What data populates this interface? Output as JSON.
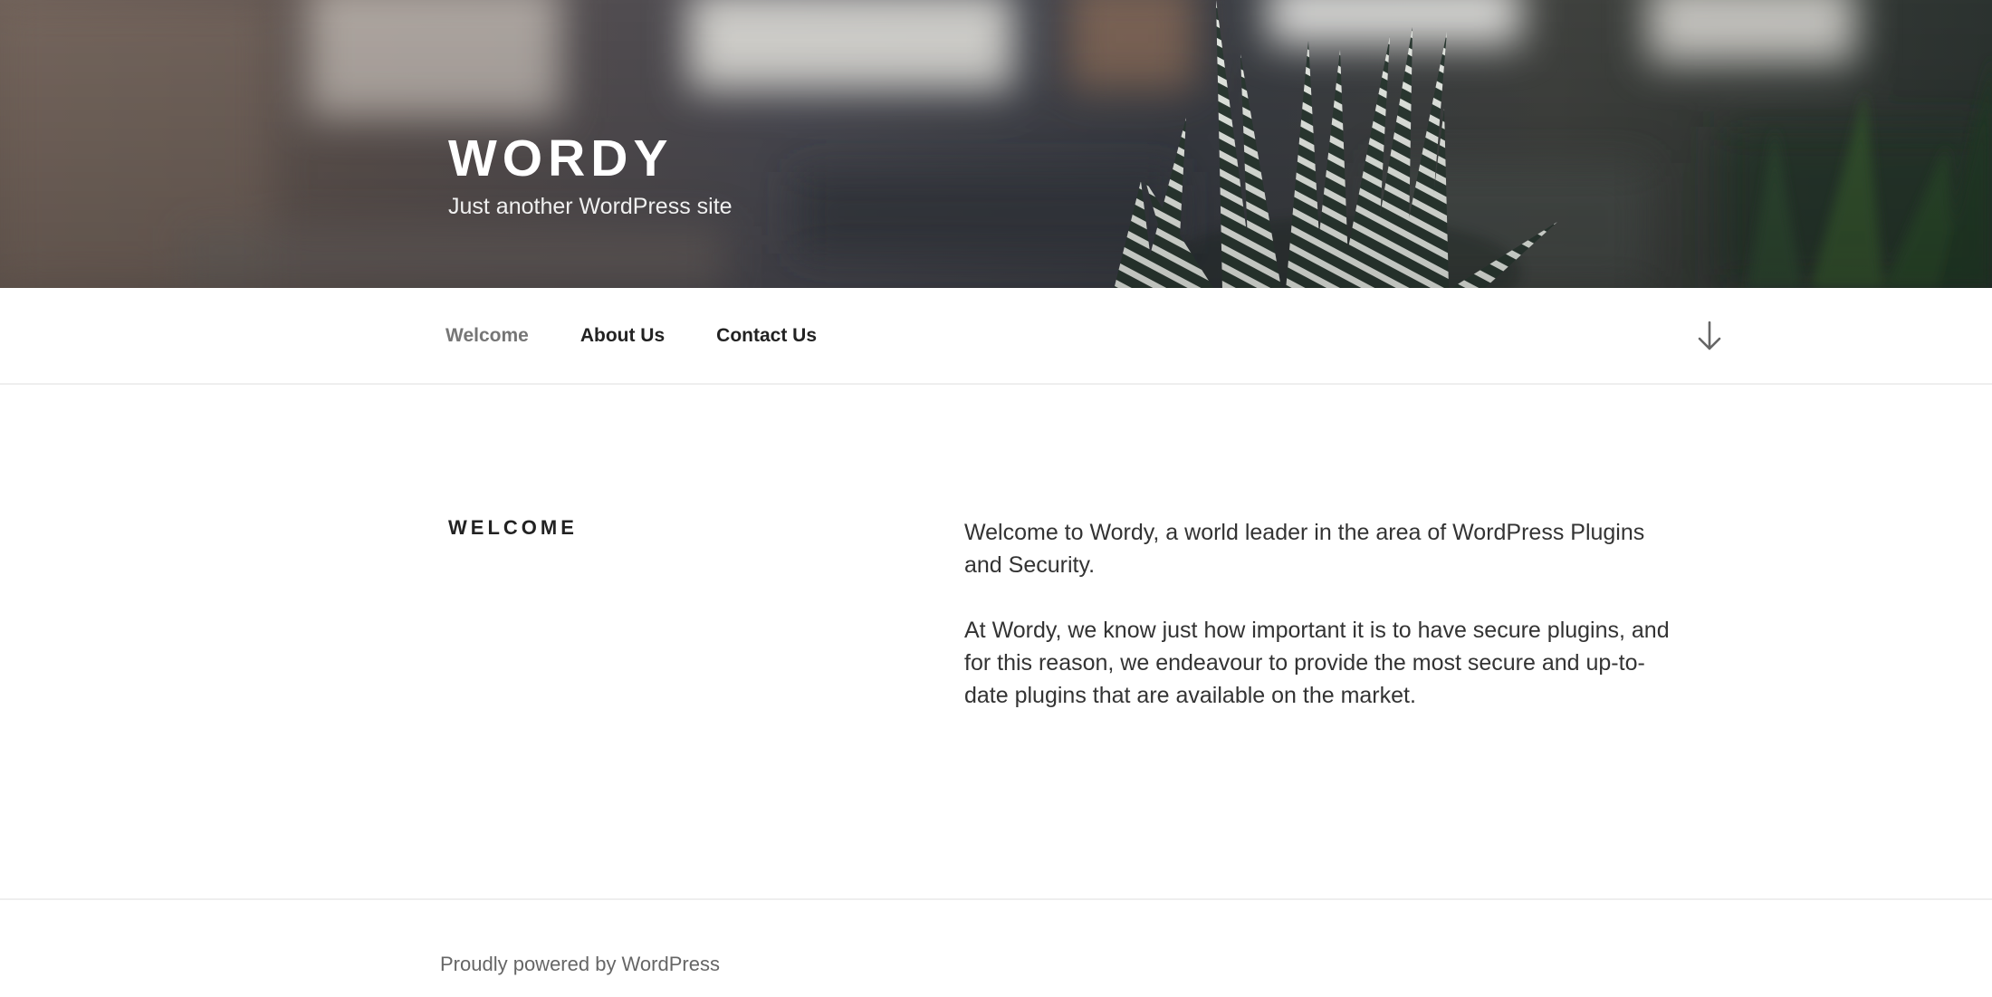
{
  "header": {
    "site_title": "WORDY",
    "site_description": "Just another WordPress site"
  },
  "nav": {
    "items": [
      {
        "label": "Welcome",
        "current": true
      },
      {
        "label": "About Us",
        "current": false
      },
      {
        "label": "Contact Us",
        "current": false
      }
    ],
    "scroll_icon": "arrow-down-icon"
  },
  "main": {
    "entry_title": "WELCOME",
    "paragraphs": [
      "Welcome to Wordy, a world leader in the area of WordPress Plugins and Security.",
      "At Wordy, we know just how important it is to have secure plugins, and for this reason, we endeavour to provide the most secure and up-to-date plugins that are available on the market."
    ]
  },
  "footer": {
    "credit": "Proudly powered by WordPress"
  },
  "colors": {
    "text": "#222222",
    "current_nav": "#767676",
    "footer_text": "#666666",
    "divider": "#eeeeee"
  }
}
